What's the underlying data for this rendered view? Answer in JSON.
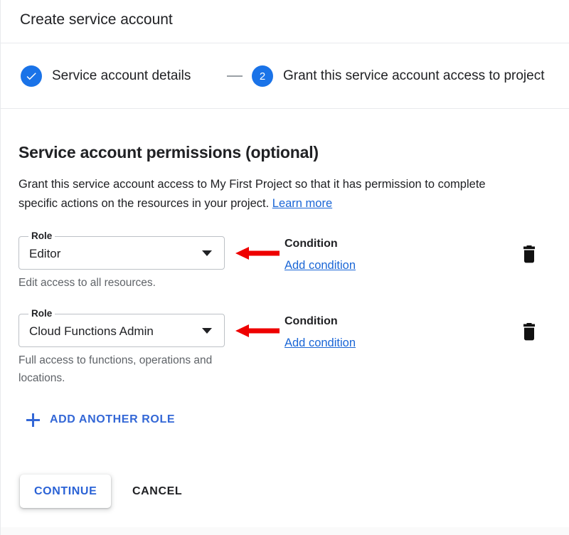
{
  "dialog": {
    "title": "Create service account"
  },
  "stepper": {
    "steps": [
      {
        "marker": "check",
        "marker_label": "",
        "label": "Service account details",
        "state": "completed"
      },
      {
        "marker": "number",
        "marker_label": "2",
        "label": "Grant this service account access to project",
        "state": "active"
      }
    ]
  },
  "main": {
    "heading": "Service account permissions (optional)",
    "description_part1": "Grant this service account access to My First Project so that it has permission to complete specific actions on the resources in your project. ",
    "description_link": "Learn more",
    "roles": [
      {
        "field_label": "Role",
        "value": "Editor",
        "helper_text": "Edit access to all resources.",
        "condition_label": "Condition",
        "condition_link": "Add condition",
        "delete_icon": "trash-icon",
        "annotation": "red-left-arrow"
      },
      {
        "field_label": "Role",
        "value": "Cloud Functions Admin",
        "helper_text": "Full access to functions, operations and locations.",
        "condition_label": "Condition",
        "condition_link": "Add condition",
        "delete_icon": "trash-icon",
        "annotation": "red-left-arrow"
      }
    ],
    "add_another_role": "ADD ANOTHER ROLE"
  },
  "actions": {
    "continue_label": "CONTINUE",
    "cancel_label": "CANCEL"
  },
  "colors": {
    "accent_blue": "#1a73e8",
    "link_blue": "#1a66d6",
    "button_blue": "#3367d6",
    "annotation_red": "#ee0000",
    "text_primary": "#202124",
    "text_secondary": "#5f6368",
    "divider": "#e8eaed",
    "field_border": "#bdc1c6"
  }
}
